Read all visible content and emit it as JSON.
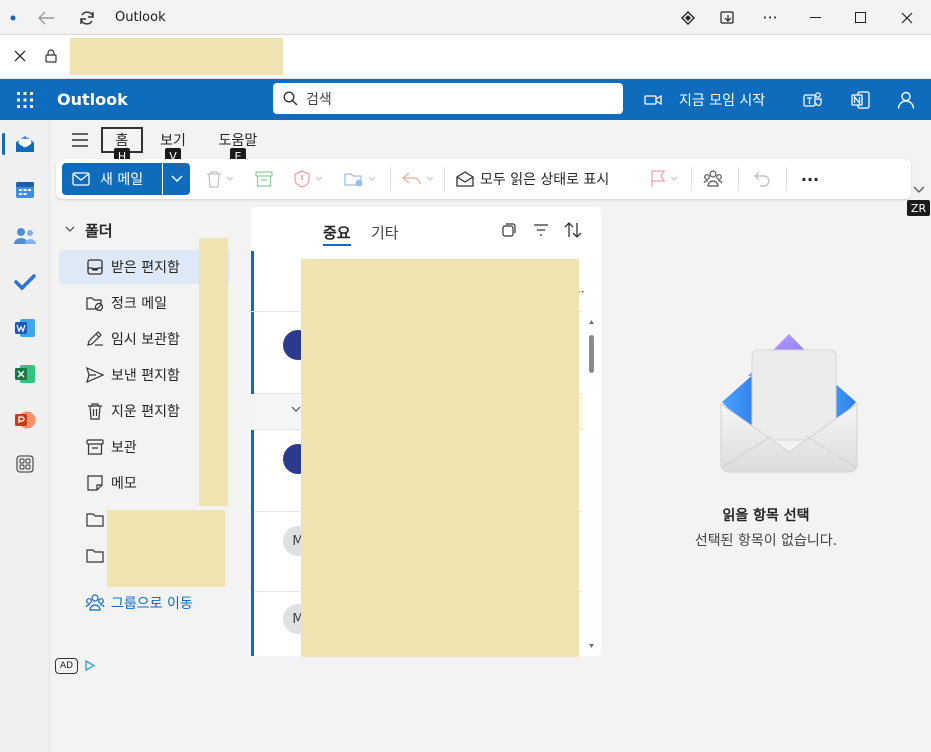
{
  "window": {
    "title": "Outlook"
  },
  "header": {
    "brand": "Outlook",
    "search_placeholder": "검색",
    "meet_now": "지금 모임 시작"
  },
  "ribbon": {
    "tabs": [
      {
        "label": "홈",
        "keytip": "H"
      },
      {
        "label": "보기",
        "keytip": "V"
      },
      {
        "label": "도움말",
        "keytip": "E"
      }
    ],
    "new_mail": "새 메일",
    "mark_all_read": "모두 읽은 상태로 표시",
    "more": "···",
    "collapse_keytip": "ZR"
  },
  "folders": {
    "header": "폴더",
    "items": [
      {
        "label": "받은 편지함",
        "icon": "inbox-icon"
      },
      {
        "label": "정크 메일",
        "icon": "junk-icon"
      },
      {
        "label": "임시 보관함",
        "icon": "drafts-icon"
      },
      {
        "label": "보낸 편지함",
        "icon": "sent-icon"
      },
      {
        "label": "지운 편지함",
        "icon": "trash-icon"
      },
      {
        "label": "보관",
        "icon": "archive-icon"
      },
      {
        "label": "메모",
        "icon": "note-icon"
      }
    ],
    "go_to_groups": "그룹으로 이동",
    "ad_badge": "AD"
  },
  "message_list": {
    "tabs": [
      "중요",
      "기타"
    ],
    "avatars": [
      "M",
      "M"
    ]
  },
  "reading_pane": {
    "title": "읽을 항목 선택",
    "subtitle": "선택된 항목이 없습니다."
  },
  "colors": {
    "brand": "#0f6cbd",
    "redaction": "#efe3b2",
    "selected": "#dde9f7"
  }
}
